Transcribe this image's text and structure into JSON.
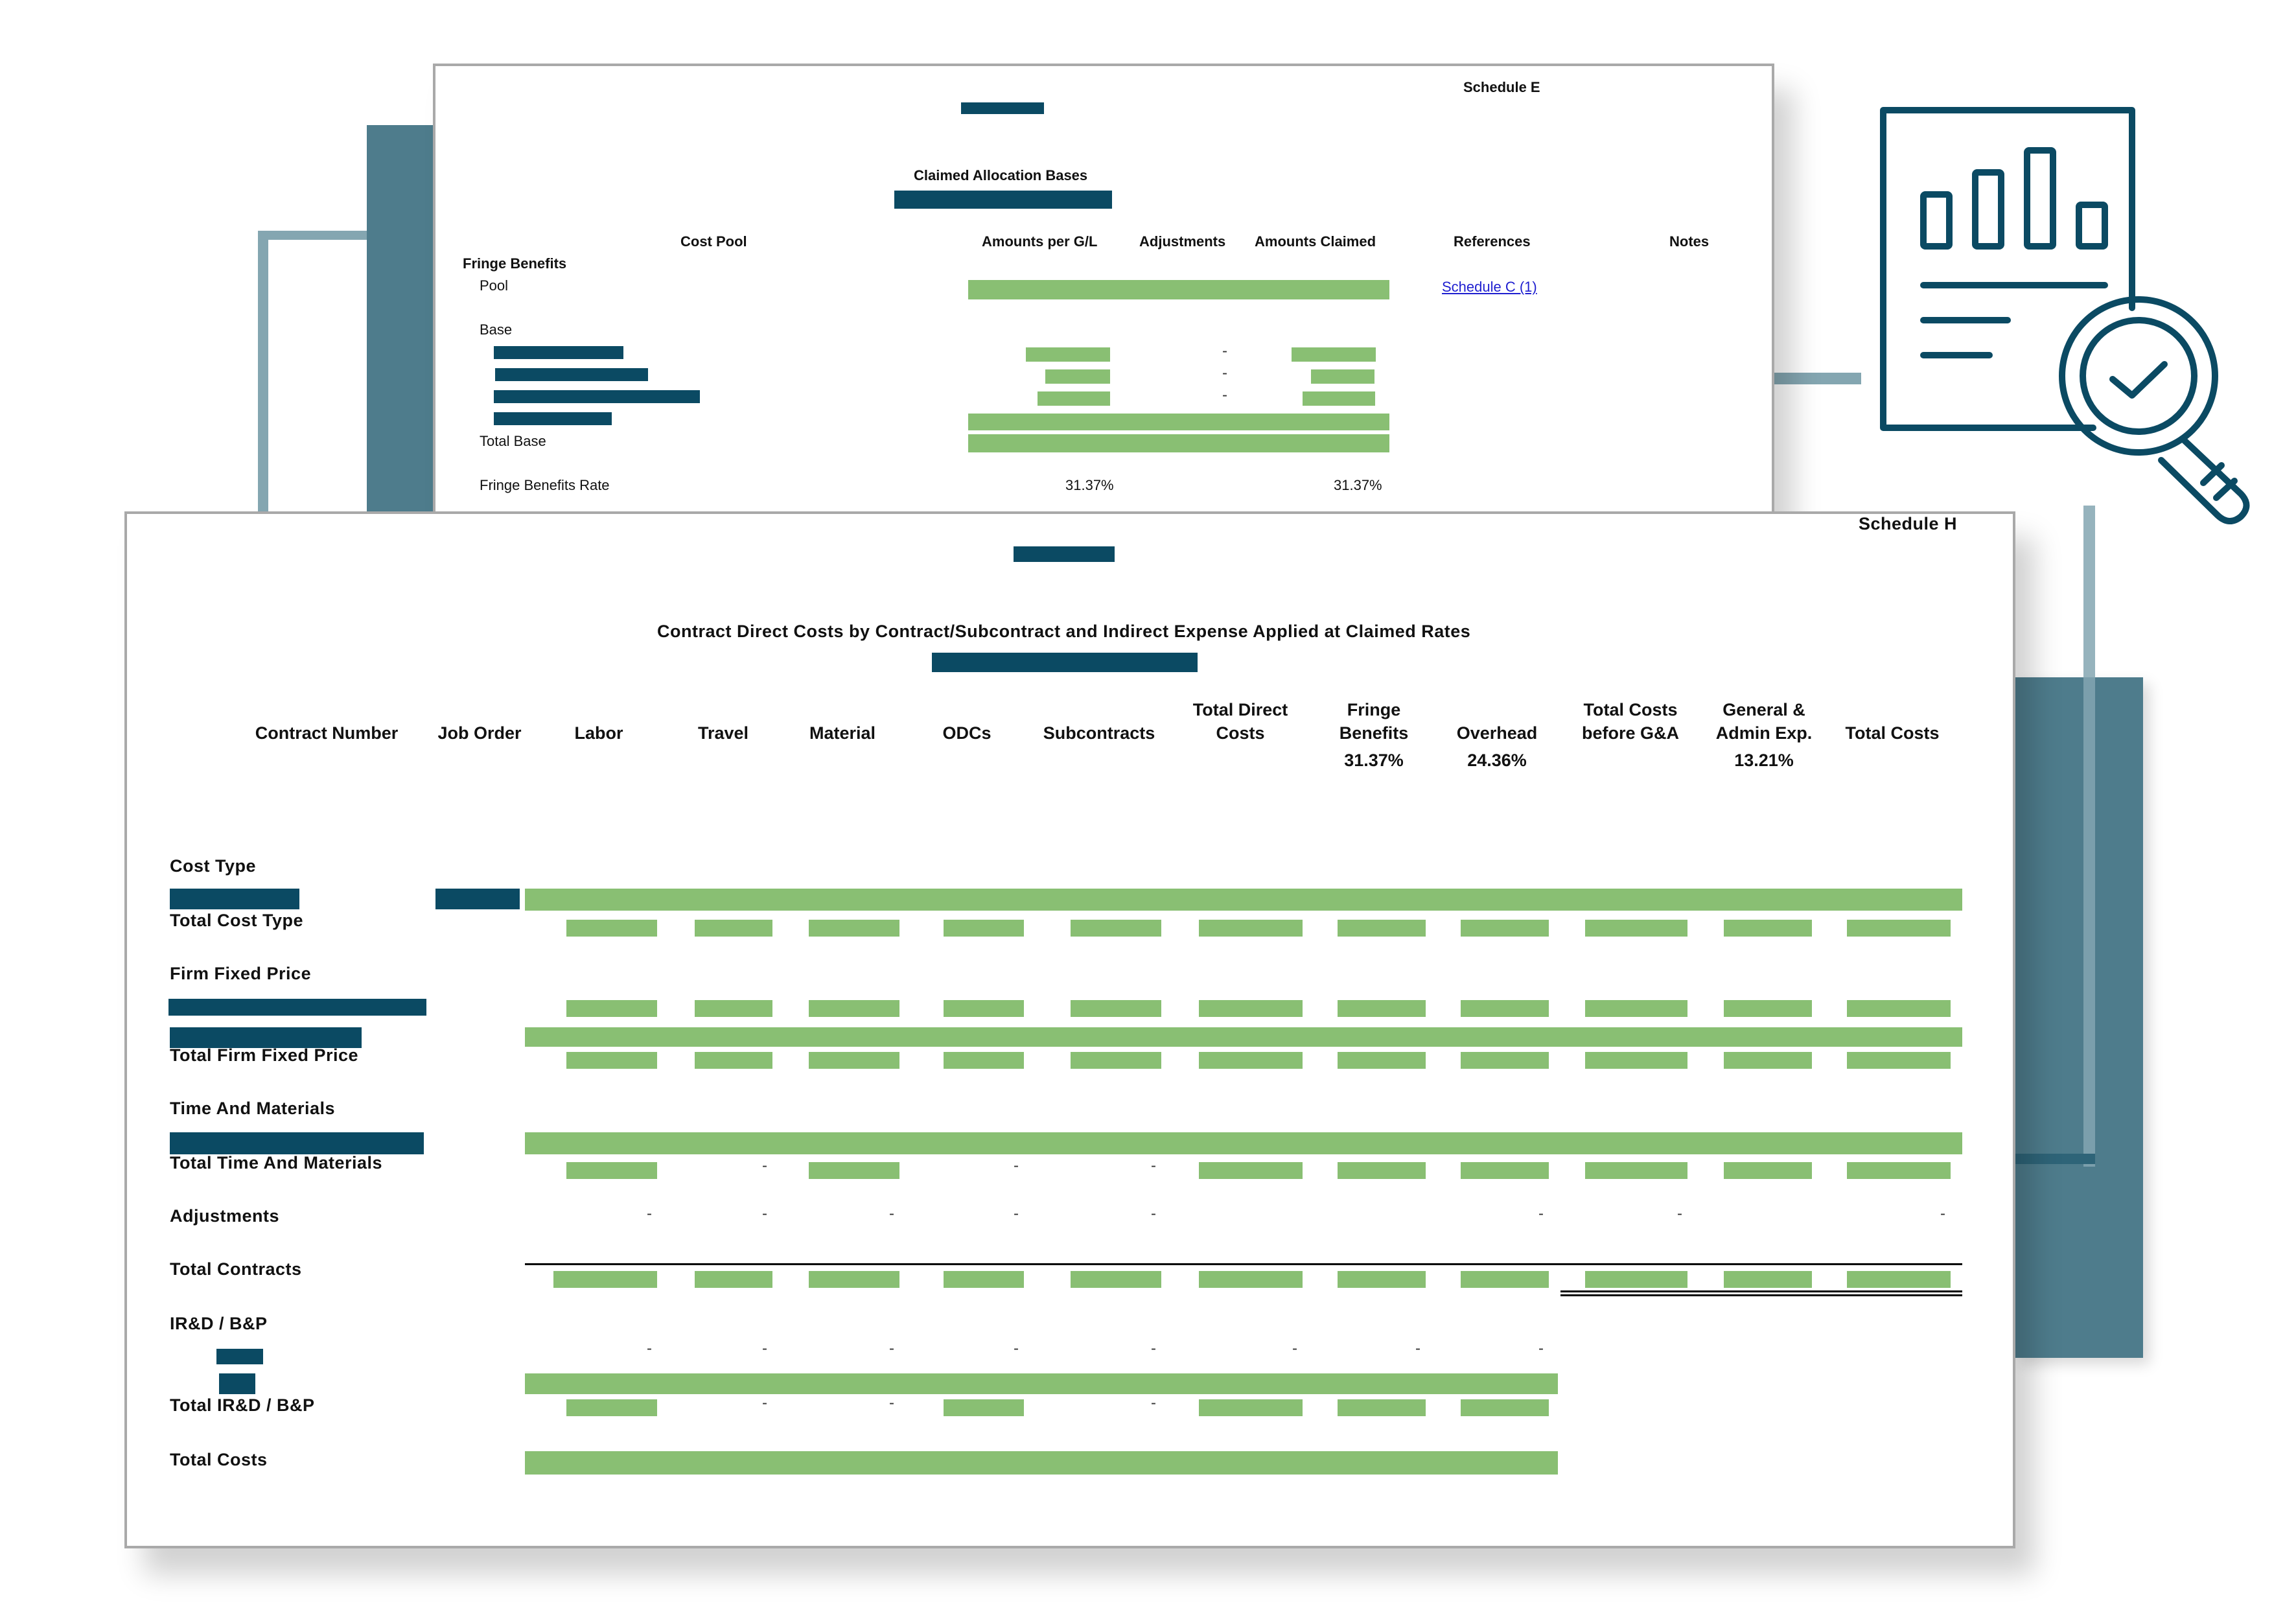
{
  "colors": {
    "redaction": "#0b4a63",
    "value_bar": "#89bf73",
    "decor_dark": "#4e7c8c",
    "decor_light": "#84a6b1",
    "link": "#1f1fd0"
  },
  "schedule_e": {
    "schedule_label": "Schedule E",
    "title": "Claimed Allocation Bases",
    "columns": [
      "Cost Pool",
      "Amounts per G/L",
      "Adjustments",
      "Amounts Claimed",
      "References",
      "Notes"
    ],
    "section": "Fringe Benefits",
    "rows": {
      "pool": "Pool",
      "base": "Base",
      "total_base": "Total Base",
      "rate_label": "Fringe Benefits Rate"
    },
    "reference_link": "Schedule C (1)",
    "adjustment_dash": "-",
    "rate_gl": "31.37%",
    "rate_claimed": "31.37%"
  },
  "schedule_h": {
    "schedule_label": "Schedule H",
    "title": "Contract Direct Costs by Contract/Subcontract and Indirect Expense Applied at Claimed Rates",
    "columns": [
      {
        "line1": "",
        "line2": "Contract Number",
        "rate": ""
      },
      {
        "line1": "",
        "line2": "Job Order",
        "rate": ""
      },
      {
        "line1": "",
        "line2": "Labor",
        "rate": ""
      },
      {
        "line1": "",
        "line2": "Travel",
        "rate": ""
      },
      {
        "line1": "",
        "line2": "Material",
        "rate": ""
      },
      {
        "line1": "",
        "line2": "ODCs",
        "rate": ""
      },
      {
        "line1": "",
        "line2": "Subcontracts",
        "rate": ""
      },
      {
        "line1": "Total Direct",
        "line2": "Costs",
        "rate": ""
      },
      {
        "line1": "Fringe",
        "line2": "Benefits",
        "rate": "31.37%"
      },
      {
        "line1": "",
        "line2": "Overhead",
        "rate": "24.36%"
      },
      {
        "line1": "Total Costs",
        "line2": "before G&A",
        "rate": ""
      },
      {
        "line1": "General &",
        "line2": "Admin Exp.",
        "rate": "13.21%"
      },
      {
        "line1": "",
        "line2": "Total Costs",
        "rate": ""
      }
    ],
    "row_labels": {
      "cost_type": "Cost Type",
      "total_cost_type": "Total Cost Type",
      "firm_fixed_price": "Firm Fixed Price",
      "total_firm_fixed_price": "Total Firm Fixed Price",
      "time_and_materials": "Time And Materials",
      "total_time_and_materials": "Total Time And Materials",
      "adjustments": "Adjustments",
      "total_contracts": "Total Contracts",
      "ird_bp": "IR&D / B&P",
      "total_ird_bp": "Total IR&D / B&P",
      "total_costs": "Total Costs"
    },
    "dash": "-"
  }
}
